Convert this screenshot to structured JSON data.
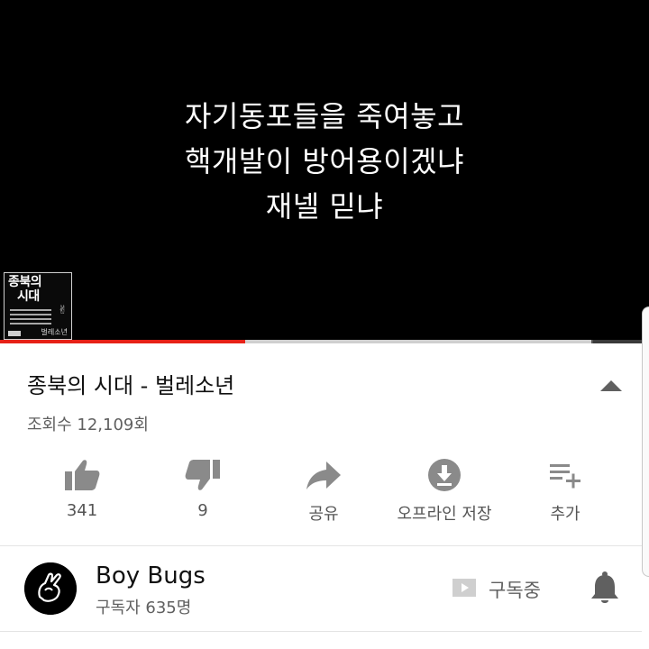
{
  "player": {
    "lyrics": [
      "자기동포들을 죽여놓고",
      "핵개발이 방어용이겠냐",
      "재넬 믿냐"
    ],
    "thumbnail_title_line1": "종북의",
    "thumbnail_title_line2": "시대",
    "thumbnail_artist": "벌레소년",
    "progress_fraction": 0.378,
    "progress_color": "#e62117"
  },
  "video": {
    "title": "종북의 시대 - 벌레소년",
    "view_count": "조회수 12,109회",
    "collapse_icon": "chevron-up-icon"
  },
  "actions": [
    {
      "label": "341",
      "icon": "thumbs-up-icon"
    },
    {
      "label": "9",
      "icon": "thumbs-down-icon"
    },
    {
      "label": "공유",
      "icon": "share-icon"
    },
    {
      "label": "오프라인 저장",
      "icon": "download-icon"
    },
    {
      "label": "추가",
      "icon": "add-to-playlist-icon"
    }
  ],
  "channel": {
    "name": "Boy Bugs",
    "subscribers": "구독자 635명",
    "subscribe_label": "구독중",
    "subscribe_icon": "play-box-icon",
    "bell_icon": "bell-icon"
  },
  "colors": {
    "icon_gray": "#8a8a8a",
    "text_secondary": "#606060"
  }
}
